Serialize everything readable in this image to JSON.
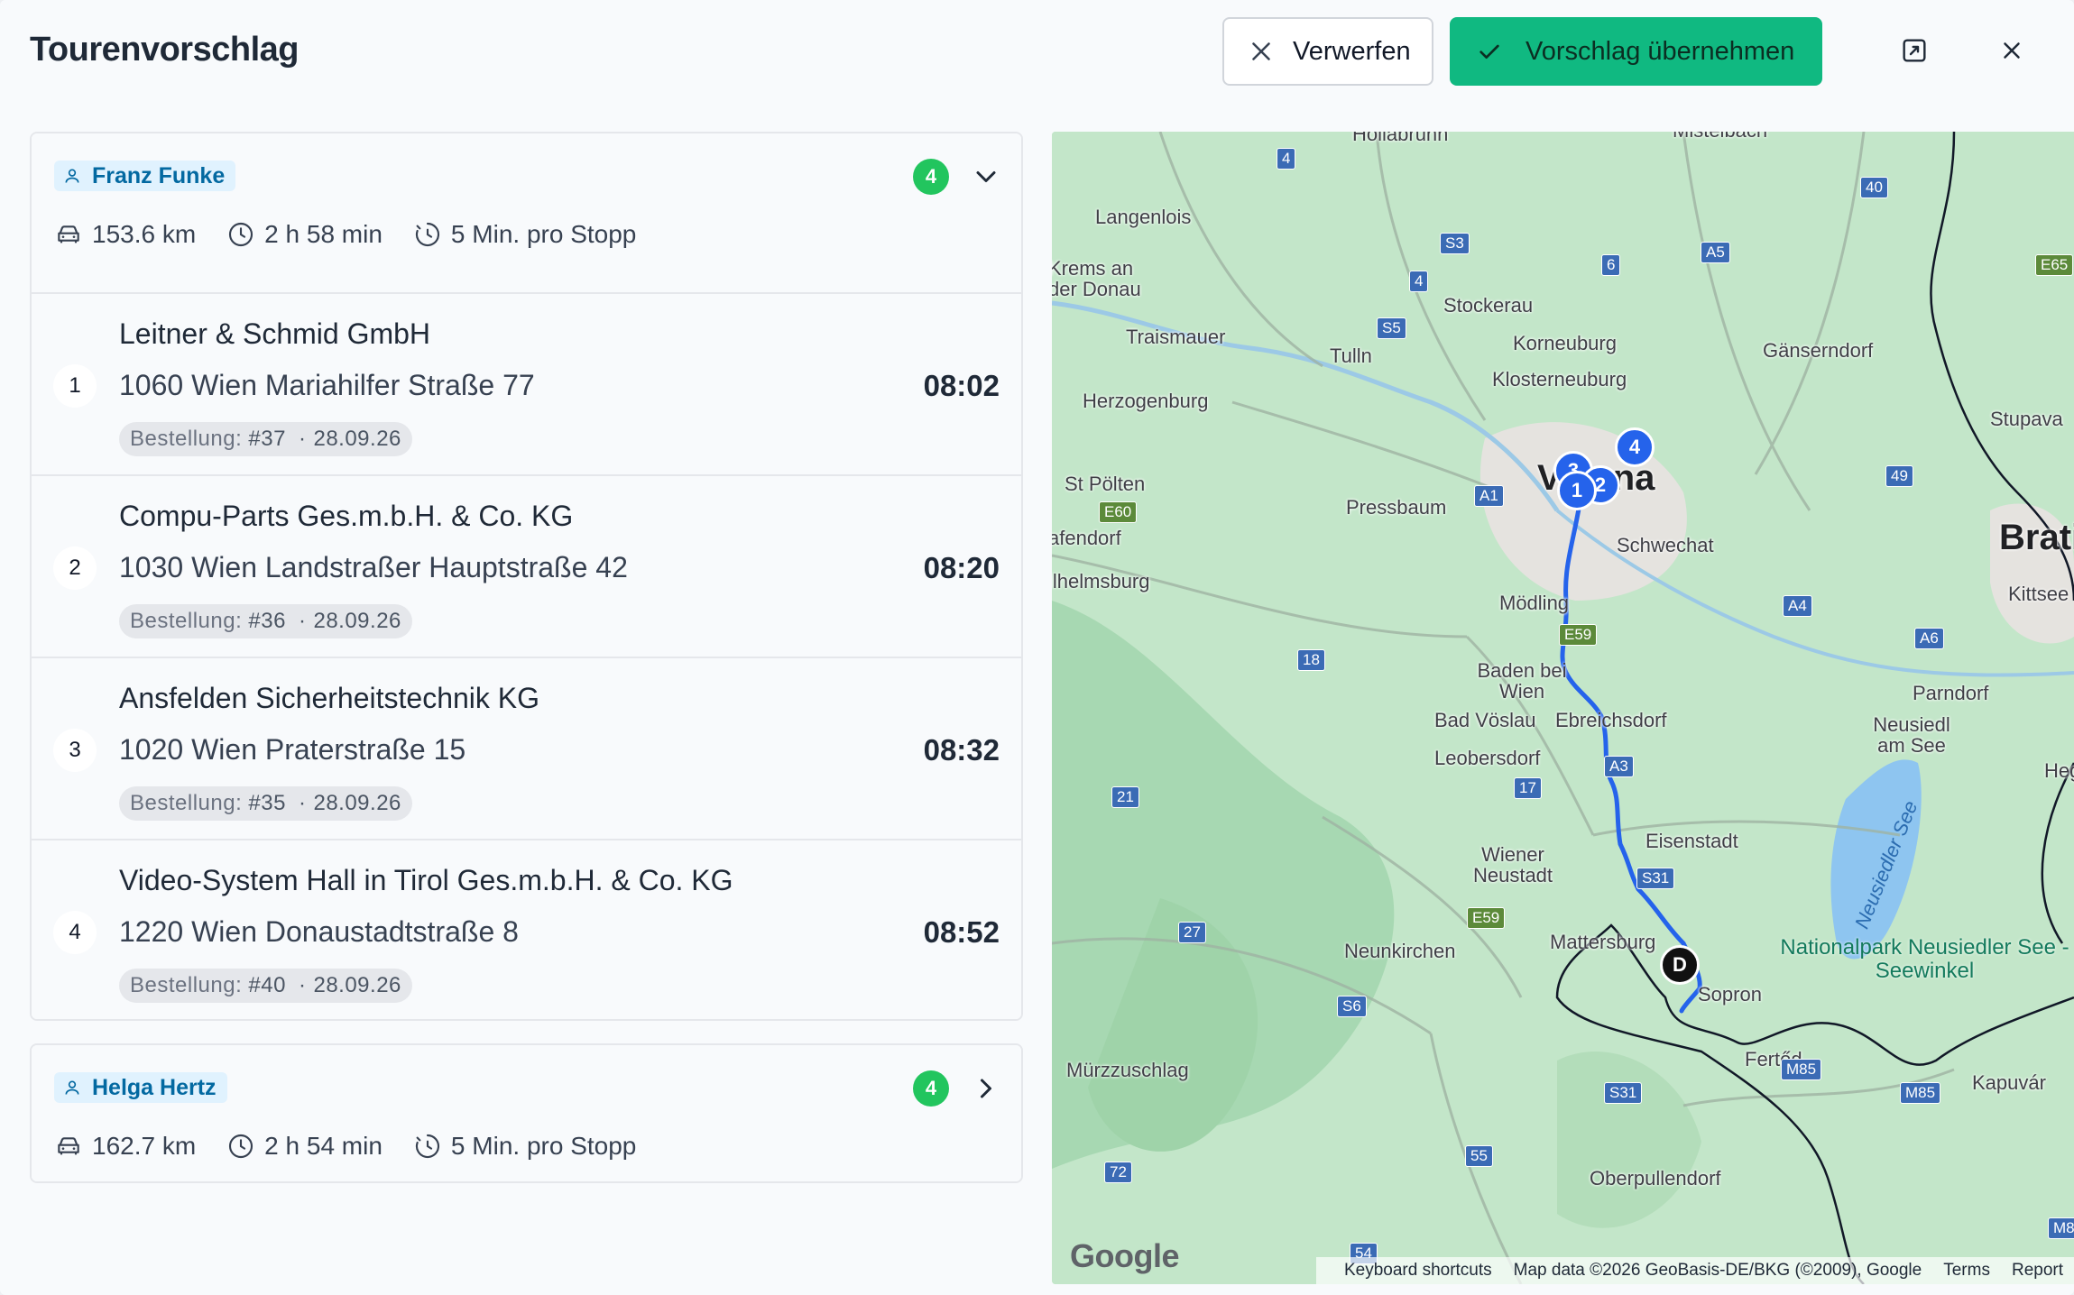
{
  "header": {
    "title": "Tourenvorschlag",
    "discard_label": "Verwerfen",
    "accept_label": "Vorschlag übernehmen",
    "colors": {
      "accept": "#10b981",
      "badge": "#22c55e",
      "route": "#2563eb"
    }
  },
  "drivers": [
    {
      "name": "Franz Funke",
      "stop_count": "4",
      "expanded": true,
      "distance": "153.6 km",
      "duration": "2 h 58 min",
      "per_stop": "5 Min. pro Stopp",
      "stops": [
        {
          "num": "1",
          "name": "Leitner & Schmid GmbH",
          "address": "1060 Wien Mariahilfer Straße 77",
          "time": "08:02",
          "order_label": "Bestellung:",
          "order_no": "#37",
          "date": "28.09.26"
        },
        {
          "num": "2",
          "name": "Compu-Parts Ges.m.b.H. & Co. KG",
          "address": "1030 Wien Landstraßer Hauptstraße 42",
          "time": "08:20",
          "order_label": "Bestellung:",
          "order_no": "#36",
          "date": "28.09.26"
        },
        {
          "num": "3",
          "name": "Ansfelden Sicherheitstechnik KG",
          "address": "1020 Wien Praterstraße 15",
          "time": "08:32",
          "order_label": "Bestellung:",
          "order_no": "#35",
          "date": "28.09.26"
        },
        {
          "num": "4",
          "name": "Video-System Hall in Tirol Ges.m.b.H. & Co. KG",
          "address": "1220 Wien Donaustadtstraße 8",
          "time": "08:52",
          "order_label": "Bestellung:",
          "order_no": "#40",
          "date": "28.09.26"
        }
      ]
    },
    {
      "name": "Helga Hertz",
      "stop_count": "4",
      "expanded": false,
      "distance": "162.7 km",
      "duration": "2 h 54 min",
      "per_stop": "5 Min. pro Stopp"
    }
  ],
  "map": {
    "towns": [
      "Hollabrunn",
      "Mistelbach",
      "Langenlois",
      "Krems an der Donau",
      "Stockerau",
      "Traismauer",
      "Tulln",
      "Korneuburg",
      "Gänserndorf",
      "Klosterneuburg",
      "Herzogenburg",
      "Stupava",
      "St Pölten",
      "Pressbaum",
      "Schwechat",
      "Bratislava",
      "afendorf",
      "ilhelmsburg",
      "Mödling",
      "Kittsee",
      "Baden bei Wien",
      "Bad Vöslau",
      "Ebreichsdorf",
      "Parndorf",
      "Neusiedl am See",
      "Leobersdorf",
      "Heg",
      "Eisenstadt",
      "Wiener Neustadt",
      "Neunkirchen",
      "Mattersburg",
      "Sopron",
      "Mürzzuschlag",
      "Fertőd",
      "Kapuvár",
      "Oberpullendorf",
      "Vienna"
    ],
    "park": "Nationalpark Neusiedler See - Seewinkel",
    "lake": "Neusiedler See",
    "shields": [
      "4",
      "S3",
      "6",
      "A5",
      "40",
      "E65",
      "4",
      "S5",
      "A1",
      "E60",
      "49",
      "A4",
      "A6",
      "18",
      "E59",
      "A3",
      "17",
      "21",
      "S31",
      "E59",
      "27",
      "S6",
      "M85",
      "S31",
      "M85",
      "72",
      "55",
      "54",
      "M8"
    ],
    "markers": [
      "1",
      "2",
      "3",
      "4",
      "D"
    ],
    "google": "Google",
    "footer": [
      "Keyboard shortcuts",
      "Map data ©2026 GeoBasis-DE/BKG (©2009), Google",
      "Terms",
      "Report"
    ]
  }
}
